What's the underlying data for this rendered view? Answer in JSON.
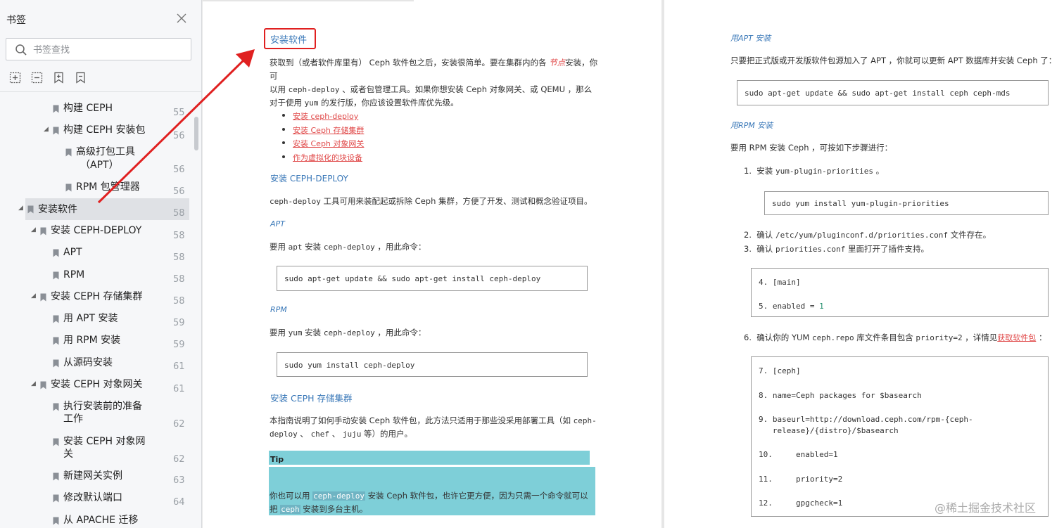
{
  "sidebar": {
    "title": "书签",
    "search_placeholder": "书签查找",
    "items": [
      {
        "label": "构建 CEPH",
        "page": "55"
      },
      {
        "label": "构建 CEPH 安装包",
        "page": "56"
      },
      {
        "label": "高级打包工具",
        "label2": "（APT）",
        "page": "56"
      },
      {
        "label": "RPM 包管理器",
        "page": "56"
      },
      {
        "label": "安装软件",
        "page": "58"
      },
      {
        "label": "安装 CEPH-DEPLOY",
        "page": "58"
      },
      {
        "label": "APT",
        "page": "58"
      },
      {
        "label": "RPM",
        "page": "58"
      },
      {
        "label": "安装 CEPH 存储集群",
        "page": "58"
      },
      {
        "label": "用 APT 安装",
        "page": "59"
      },
      {
        "label": "用 RPM 安装",
        "page": "59"
      },
      {
        "label": "从源码安装",
        "page": "61"
      },
      {
        "label": "安装 CEPH 对象网关",
        "page": "61"
      },
      {
        "label": "执行安装前的准备",
        "label2": "工作",
        "page": "62"
      },
      {
        "label": "安装 CEPH 对象网",
        "label2": "关",
        "page": "62"
      },
      {
        "label": "新建网关实例",
        "page": "63"
      },
      {
        "label": "修改默认端口",
        "page": "64"
      },
      {
        "label": "从 APACHE 迁移",
        "page": ""
      }
    ]
  },
  "page1": {
    "title": "安装软件",
    "intro": {
      "l1a": "获取到（或者软件库里有） Ceph 软件包之后，安装很简单。要在集群内的各 ",
      "l1_node": "节点",
      "l1b": "安装，你可",
      "l2a": "以用 ",
      "l2_cmd1": "ceph-deploy",
      "l2b": " 、或者包管理工具。如果你想安装 Ceph 对象网关、或 QEMU ，那么",
      "l3a": "对于使用 ",
      "l3_cmd": "yum",
      "l3b": " 的发行版，你应该设置软件库优先级。"
    },
    "links": [
      "安装 ceph-deploy",
      "安装 Ceph 存储集群",
      "安装 Ceph 对象网关",
      "作为虚拟化的块设备"
    ],
    "h_deploy": "安装 CEPH-DEPLOY",
    "deploy_desc_cmd": "ceph-deploy",
    "deploy_desc": " 工具可用来装配起或拆除 Ceph 集群，方便了开发、测试和概念验证项目。",
    "apt_head": "APT",
    "apt_desc_a": "要用 ",
    "apt_desc_cmd1": "apt",
    "apt_desc_b": " 安装 ",
    "apt_desc_cmd2": "ceph-deploy",
    "apt_desc_c": " ，用此命令：",
    "apt_code": "sudo apt-get update && sudo apt-get install ceph-deploy",
    "rpm_head": "RPM",
    "rpm_desc_a": "要用 ",
    "rpm_desc_cmd1": "yum",
    "rpm_desc_b": " 安装 ",
    "rpm_desc_cmd2": "ceph-deploy",
    "rpm_desc_c": " ，用此命令：",
    "rpm_code": "sudo yum install ceph-deploy",
    "h_storage": "安装 CEPH 存储集群",
    "storage_l1a": "本指南说明了如何手动安装 Ceph 软件包，此方法只适用于那些没采用部署工具（如 ",
    "storage_l1_cmd": "ceph-",
    "storage_l2_cmd1": "deploy",
    "storage_l2a": " 、 ",
    "storage_l2_cmd2": "chef",
    "storage_l2b": " 、 ",
    "storage_l2_cmd3": "juju",
    "storage_l2c": " 等）的用户。",
    "tip_head": "Tip",
    "tip_l1a": "你也可以用 ",
    "tip_l1_cmd": "ceph-deploy",
    "tip_l1b": " 安装 Ceph 软件包，也许它更方便，因为只需一个命令就可以",
    "tip_l2a": "把 ",
    "tip_l2_cmd": "ceph",
    "tip_l2b": " 安装到多台主机。"
  },
  "page2": {
    "h_apt": "用APT 安装",
    "apt_desc": "只要把正式版或开发版软件包源加入了 APT ，你就可以更新 APT 数据库并安装 Ceph 了：",
    "apt_code": "sudo apt-get update && sudo apt-get install ceph ceph-mds",
    "h_rpm": "用RPM 安装",
    "rpm_desc": "要用 RPM 安装 Ceph ，可按如下步骤进行：",
    "step1_num": "1.",
    "step1a": "安装 ",
    "step1_cmd": "yum-plugin-priorities",
    "step1b": " 。",
    "step1_code": "sudo yum install yum-plugin-priorities",
    "step2_num": "2.",
    "step2a": "确认 ",
    "step2_cmd": "/etc/yum/pluginconf.d/priorities.conf",
    "step2b": " 文件存在。",
    "step3_num": "3.",
    "step3a": "确认 ",
    "step3_cmd": "priorities.conf",
    "step3b": " 里面打开了插件支持。",
    "code2_l1": "4. [main]",
    "code2_l2a": "5. enabled = ",
    "code2_l2b": "1",
    "step6_num": "6.",
    "step6a": "确认你的 YUM ",
    "step6_cmd1": "ceph.repo",
    "step6b": " 库文件条目包含 ",
    "step6_cmd2": "priority=2",
    "step6c": " ，详情见",
    "step6_link": "获取软件包",
    "step6d": " ：",
    "code3": [
      "7. [ceph]",
      "8. name=Ceph packages for $basearch",
      "9. baseurl=http://download.ceph.com/rpm-{ceph-",
      "   release}/{distro}/$basearch",
      "10.     enabled=1",
      "11.     priority=2",
      "12.     gpgcheck=1"
    ]
  },
  "watermark": "@稀土掘金技术社区",
  "colors": {
    "accent": "#3a78b8",
    "link": "#e04848",
    "tip": "#7ecfd8",
    "annotation": "#e02020"
  }
}
